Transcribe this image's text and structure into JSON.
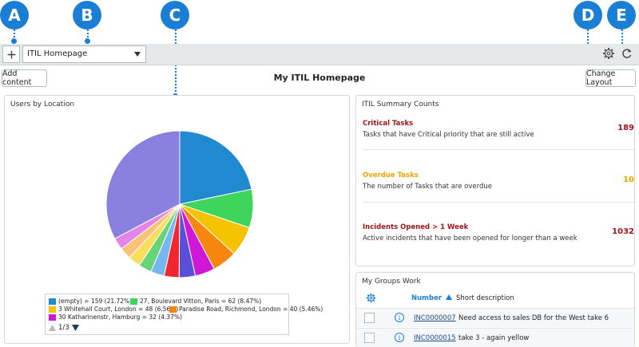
{
  "callouts": [
    "A",
    "B",
    "C",
    "D",
    "E"
  ],
  "toolbar": {
    "add_icon": "plus-icon",
    "dashboard_select": "ITIL Homepage",
    "settings_icon": "gear-icon",
    "refresh_icon": "refresh-icon"
  },
  "header": {
    "add_content": "Add content",
    "title": "My ITIL Homepage",
    "change_layout": "Change Layout"
  },
  "users_by_location": {
    "title": "Users by Location",
    "legend": [
      {
        "label": "(empty) = 159 (21.72%)",
        "color": "#2189d0"
      },
      {
        "label": "27, Boulevard Vitton, Paris = 62 (8.47%)",
        "color": "#3fd45c"
      },
      {
        "label": "3 Whitehall Court, London = 48 (6.56%)",
        "color": "#f6c300"
      },
      {
        "label": "Paradise Road, Richmond, London = 40 (5.46%)",
        "color": "#f7860f"
      },
      {
        "label": "30 Katharinenstr, Hamburg = 32 (4.37%)",
        "color": "#d016d6"
      }
    ],
    "pager": "1/3"
  },
  "chart_data": {
    "type": "pie",
    "title": "Users by Location",
    "slices": [
      {
        "label": "(empty)",
        "value": 159,
        "percent": 21.72,
        "color": "#2189d0"
      },
      {
        "label": "27, Boulevard Vitton, Paris",
        "value": 62,
        "percent": 8.47,
        "color": "#3fd45c"
      },
      {
        "label": "3 Whitehall Court, London",
        "value": 48,
        "percent": 6.56,
        "color": "#f6c300"
      },
      {
        "label": "Paradise Road, Richmond, London",
        "value": 40,
        "percent": 5.46,
        "color": "#f7860f"
      },
      {
        "label": "30 Katharinenstr, Hamburg",
        "value": 32,
        "percent": 4.37,
        "color": "#d016d6"
      },
      {
        "label": "",
        "value": 26,
        "percent": 3.6,
        "color": "#5a4fd9"
      },
      {
        "label": "",
        "value": 24,
        "percent": 3.3,
        "color": "#f0282d"
      },
      {
        "label": "",
        "value": 22,
        "percent": 3.0,
        "color": "#78b6f2"
      },
      {
        "label": "",
        "value": 21,
        "percent": 2.9,
        "color": "#66d477"
      },
      {
        "label": "",
        "value": 20,
        "percent": 2.7,
        "color": "#f9dd5c"
      },
      {
        "label": "",
        "value": 19,
        "percent": 2.6,
        "color": "#f9c27b"
      },
      {
        "label": "",
        "value": 19,
        "percent": 2.6,
        "color": "#e385e6"
      },
      {
        "label": "",
        "value": 240,
        "percent": 32.7,
        "color": "#8a80e0"
      }
    ]
  },
  "summary": {
    "title": "ITIL Summary Counts",
    "items": [
      {
        "title": "Critical Tasks",
        "desc": "Tasks that have Critical priority that are still active",
        "count": "189",
        "color": "#a3141a"
      },
      {
        "title": "Overdue Tasks",
        "desc": "The number of Tasks that are overdue",
        "count": "10",
        "color": "#f0a400"
      },
      {
        "title": "Incidents Opened > 1 Week",
        "desc": "Active incidents that have been opened for longer than a week",
        "count": "1032",
        "color": "#a3141a"
      }
    ]
  },
  "groups_work": {
    "title": "My Groups Work",
    "columns": {
      "number": "Number",
      "short_description": "Short description"
    },
    "rows": [
      {
        "number": "INC0000007",
        "desc": "Need access to sales DB for the West take 6"
      },
      {
        "number": "INC0000015",
        "desc": "take 3 - again yellow"
      }
    ]
  }
}
